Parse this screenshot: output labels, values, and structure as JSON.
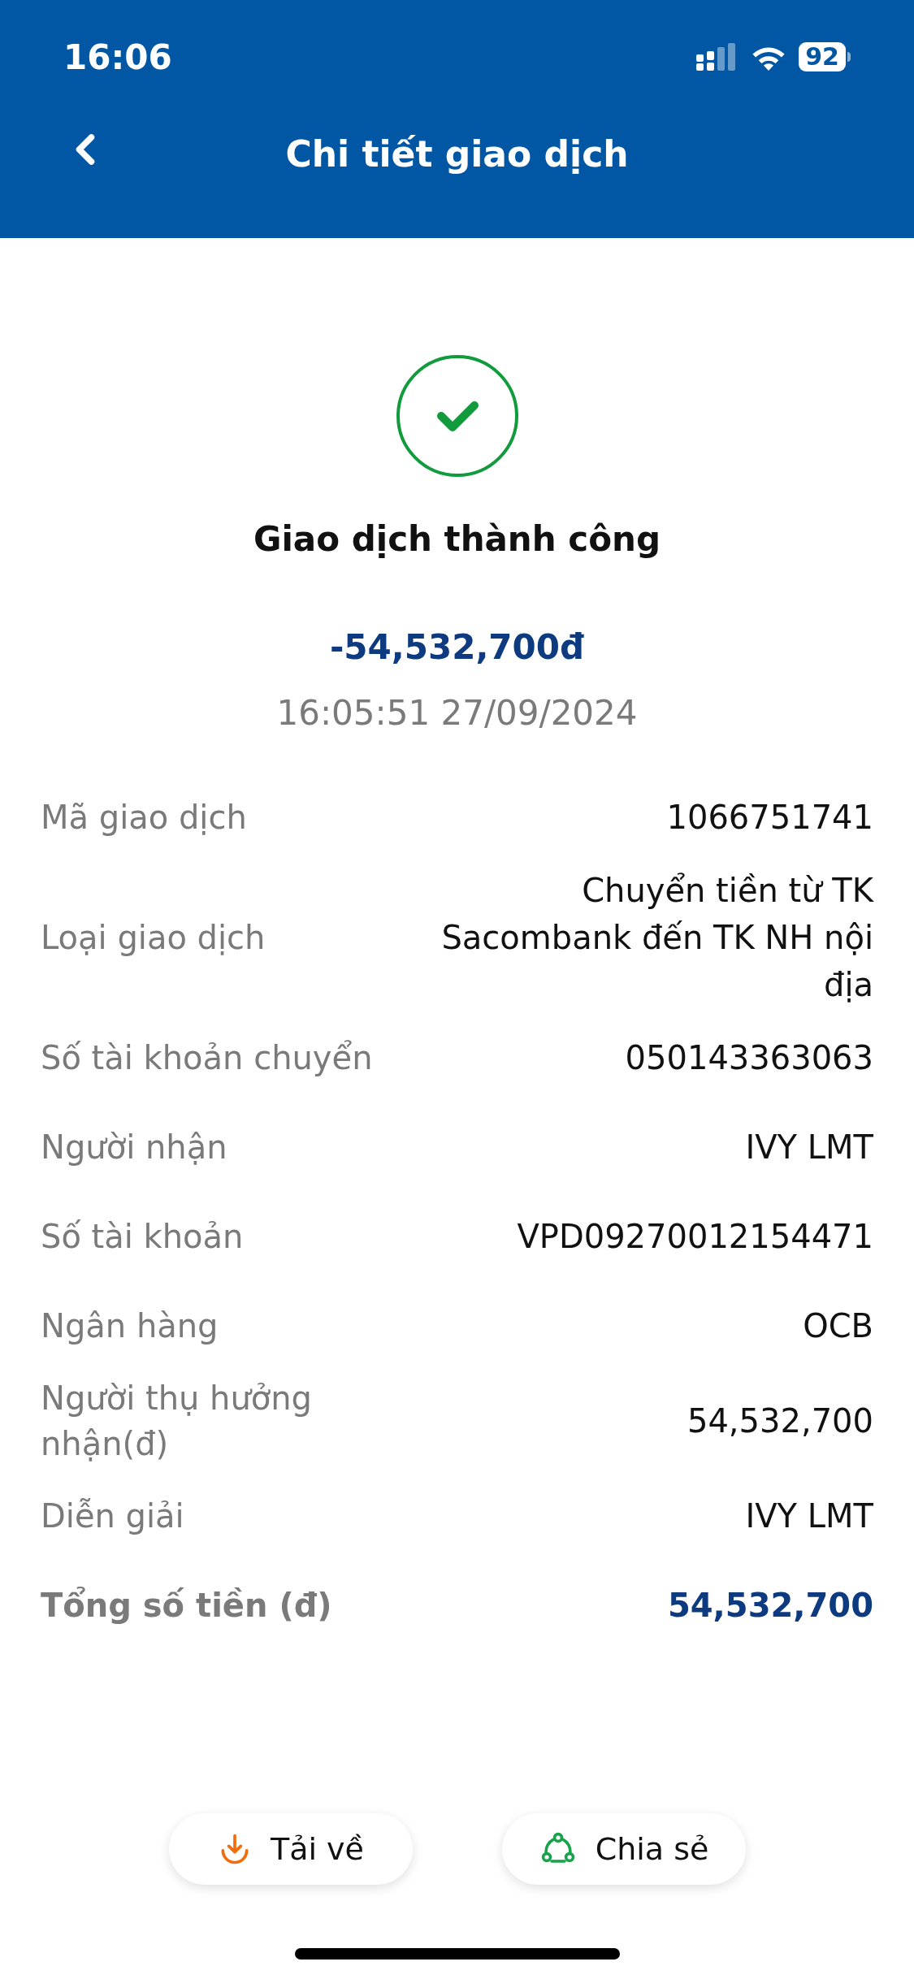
{
  "status_bar": {
    "time": "16:06",
    "battery": "92"
  },
  "header": {
    "title": "Chi tiết giao dịch"
  },
  "result": {
    "kind": "success",
    "title": "Giao dịch thành công",
    "amount": "-54,532,700đ",
    "datetime": "16:05:51 27/09/2024"
  },
  "details": [
    {
      "kind": "normal",
      "label": "Mã giao dịch",
      "value": "1066751741"
    },
    {
      "kind": "normal",
      "label": "Loại giao dịch",
      "value": "Chuyển tiền từ TK Sacombank đến TK NH nội địa"
    },
    {
      "kind": "normal",
      "label": "Số tài khoản chuyển",
      "value": "050143363063"
    },
    {
      "kind": "normal",
      "label": "Người nhận",
      "value": "IVY LMT"
    },
    {
      "kind": "normal",
      "label": "Số tài khoản",
      "value": "VPD09270012154471"
    },
    {
      "kind": "normal",
      "label": "Ngân hàng",
      "value": "OCB"
    },
    {
      "kind": "normal",
      "label": "Người thụ hưởng nhận(đ)",
      "value": "54,532,700"
    },
    {
      "kind": "normal",
      "label": "Diễn giải",
      "value": "IVY LMT"
    },
    {
      "kind": "total",
      "label": "Tổng số tiền (đ)",
      "value": "54,532,700"
    }
  ],
  "actions": [
    {
      "kind": "download",
      "label": "Tải về"
    },
    {
      "kind": "share",
      "label": "Chia sẻ"
    }
  ]
}
